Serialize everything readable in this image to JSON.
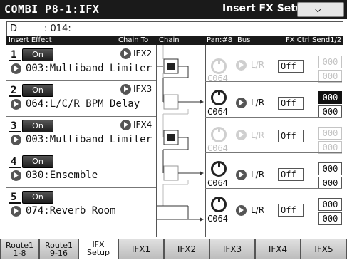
{
  "title": {
    "left": "COMBI P8-1:IFX",
    "right": "Insert FX Setup"
  },
  "name_row": {
    "prefix": "D",
    "number": ": 014:"
  },
  "headers": {
    "insert_effect": "Insert Effect",
    "chain_to": "Chain To",
    "chain": "Chain",
    "pan": "Pan:#8",
    "bus": "Bus",
    "fx_ctrl": "FX Ctrl",
    "send": "Send1/2"
  },
  "slots": [
    {
      "num": "1",
      "on": "On",
      "chain_to": "IFX2",
      "effect": "003:Multiband Limiter",
      "pan": "C064",
      "bus": "L/R",
      "fx_ctrl": "Off",
      "send1": "000",
      "send2": "000",
      "dim": true
    },
    {
      "num": "2",
      "on": "On",
      "chain_to": "IFX3",
      "effect": "064:L/C/R BPM Delay",
      "pan": "C064",
      "bus": "L/R",
      "fx_ctrl": "Off",
      "send1": "000",
      "send2": "000",
      "dim": false
    },
    {
      "num": "3",
      "on": "On",
      "chain_to": "IFX4",
      "effect": "003:Multiband Limiter",
      "pan": "C064",
      "bus": "L/R",
      "fx_ctrl": "Off",
      "send1": "000",
      "send2": "000",
      "dim": true
    },
    {
      "num": "4",
      "on": "On",
      "chain_to": "",
      "effect": "030:Ensemble",
      "pan": "C064",
      "bus": "L/R",
      "fx_ctrl": "Off",
      "send1": "000",
      "send2": "000",
      "dim": false
    },
    {
      "num": "5",
      "on": "On",
      "chain_to": "",
      "effect": "074:Reverb Room",
      "pan": "C064",
      "bus": "L/R",
      "fx_ctrl": "Off",
      "send1": "000",
      "send2": "000",
      "dim": false
    }
  ],
  "tabs": [
    {
      "line1": "Route1",
      "line2": "1-8"
    },
    {
      "line1": "Route1",
      "line2": "9-16"
    },
    {
      "line1": "IFX",
      "line2": "Setup"
    },
    {
      "line1": "IFX1",
      "line2": ""
    },
    {
      "line1": "IFX2",
      "line2": ""
    },
    {
      "line1": "IFX3",
      "line2": ""
    },
    {
      "line1": "IFX4",
      "line2": ""
    },
    {
      "line1": "IFX5",
      "line2": ""
    }
  ],
  "icons": {
    "menu": "chevron-down-icon",
    "arrow": "play-arrow-icon",
    "knob": "pan-knob-icon"
  },
  "colors": {
    "titlebar": "#1a1a1a",
    "dimmed": "#c4c4c4",
    "selected": "#111111"
  }
}
